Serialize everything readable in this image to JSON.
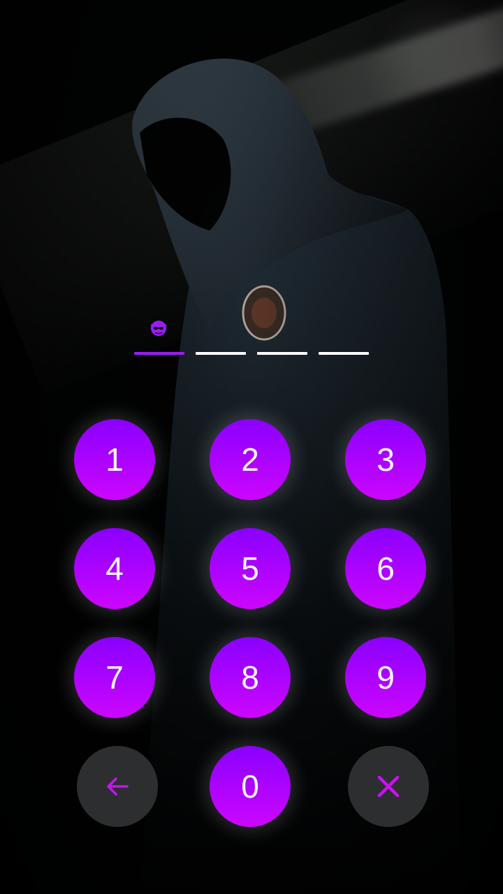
{
  "pin": {
    "slots": 4,
    "filled": 0,
    "user_icon": "incognito-user-icon"
  },
  "keypad": {
    "keys": [
      "1",
      "2",
      "3",
      "4",
      "5",
      "6",
      "7",
      "8",
      "9",
      "0"
    ],
    "back_icon": "arrow-left-icon",
    "clear_icon": "close-icon"
  },
  "colors": {
    "accent_top": "#8a00ff",
    "accent_bottom": "#cc06ff",
    "action_key": "#2c2e30",
    "slot_active": "#9b1cf2",
    "slot_inactive": "#ffffff"
  }
}
